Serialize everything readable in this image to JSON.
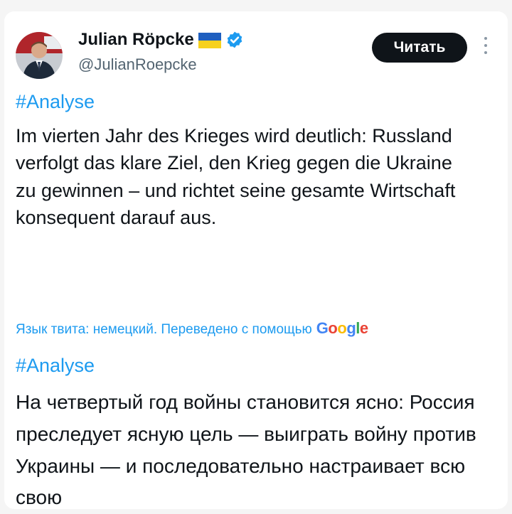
{
  "author": {
    "name": "Julian Röpcke",
    "handle": "@JulianRoepcke",
    "verified": true,
    "flag": "ukraine-flag",
    "avatar_icon": "avatar-photo"
  },
  "actions": {
    "read_label": "Читать",
    "more_icon": "more-vertical-icon"
  },
  "tweet": {
    "hashtag": "#Analyse",
    "text": "Im vierten Jahr des Krieges wird deutlich: Russland verfolgt das klare Ziel, den Krieg gegen die Ukraine zu gewinnen – und richtet seine gesamte Wirtschaft konsequent darauf aus."
  },
  "translation": {
    "note": "Язык твита: немецкий. Переведено с помощью",
    "provider": "Google",
    "hashtag": "#Analyse",
    "text": "На четвертый год войны становится ясно: Россия преследует ясную цель — выиграть войну против Украины — и последовательно настраивает всю свою"
  },
  "colors": {
    "link": "#1d9bf0",
    "text": "#0f1419",
    "muted": "#536471",
    "button_bg": "#0f1419",
    "verified": "#1d9bf0"
  }
}
